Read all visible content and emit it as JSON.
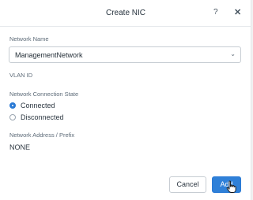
{
  "dialog": {
    "title": "Create NIC",
    "help_icon": "?",
    "close_icon": "✕"
  },
  "form": {
    "network_name_label": "Network Name",
    "network_name_value": "ManagementNetwork",
    "vlan_label": "VLAN ID",
    "connection_state_label": "Network Connection State",
    "connection_options": [
      {
        "label": "Connected",
        "selected": true
      },
      {
        "label": "Disconnected",
        "selected": false
      }
    ],
    "address_label": "Network Address / Prefix",
    "address_value": "NONE"
  },
  "footer": {
    "cancel_label": "Cancel",
    "add_label": "Add"
  },
  "colors": {
    "accent": "#2f80d8"
  }
}
